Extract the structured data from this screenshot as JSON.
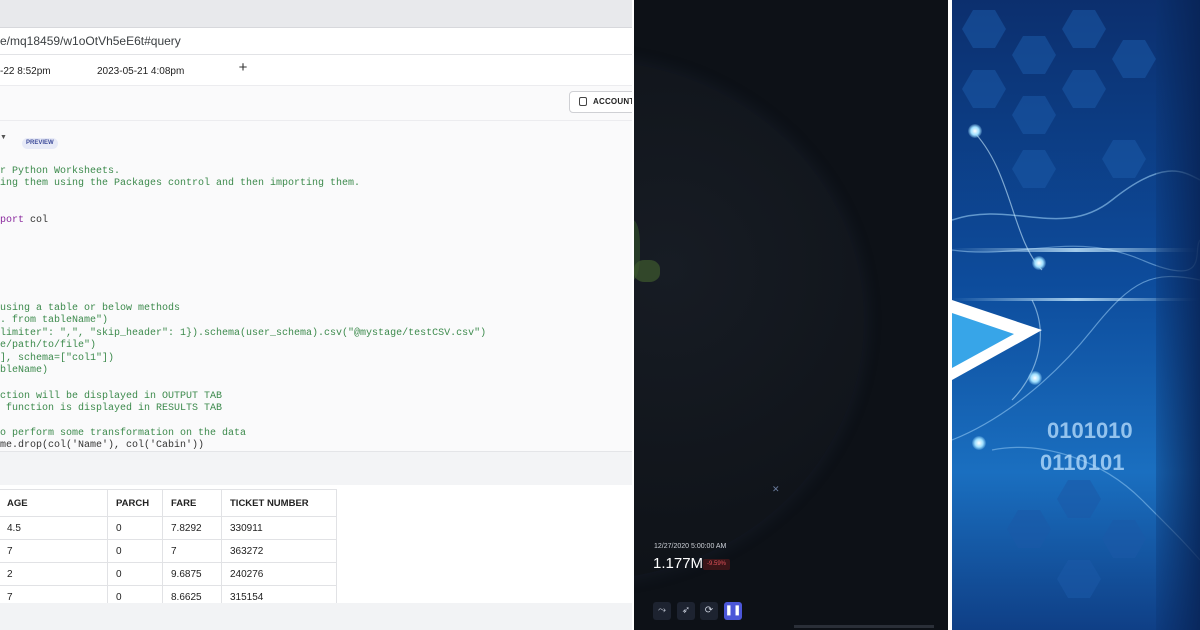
{
  "worksheet": {
    "url": "e/mq18459/w1oOtVh5eE6t#query",
    "tabs": [
      "-22 8:52pm",
      "2023-05-21 4:08pm"
    ],
    "account_label": "ACCOUNT",
    "preview_badge": "PREVIEW",
    "code_lines": [
      {
        "text": "r Python Worksheets.",
        "color": "green"
      },
      {
        "text": "ing them using the Packages control and then importing them.",
        "color": "green"
      },
      {
        "text": "port col",
        "color": "mixed"
      },
      {
        "text": "using a table or below methods",
        "color": "green"
      },
      {
        "text": ". from tableName\")",
        "color": "green"
      },
      {
        "text": "limiter\": \",\", \"skip_header\": 1}).schema(user_schema).csv(\"@mystage/testCSV.csv\")",
        "color": "green"
      },
      {
        "text": "e/path/to/file\")",
        "color": "green"
      },
      {
        "text": "], schema=[\"col1\"])",
        "color": "green"
      },
      {
        "text": "bleName)",
        "color": "green"
      },
      {
        "text": "ction will be displayed in OUTPUT TAB",
        "color": "green"
      },
      {
        "text": " function is displayed in RESULTS TAB",
        "color": "green"
      },
      {
        "text": "o perform some transformation on the data",
        "color": "green"
      },
      {
        "text": "me.drop(col('Name'), col('Cabin'))",
        "color": "dark"
      }
    ],
    "results": {
      "columns": [
        "AGE",
        "PARCH",
        "FARE",
        "TICKET NUMBER"
      ],
      "rows": [
        [
          "4.5",
          "0",
          "7.8292",
          "330911"
        ],
        [
          "7",
          "0",
          "7",
          "363272"
        ],
        [
          "2",
          "0",
          "9.6875",
          "240276"
        ],
        [
          "7",
          "0",
          "8.6625",
          "315154"
        ]
      ]
    }
  },
  "stats": {
    "timestamp": "12/27/2020 5:00:00 AM",
    "value": "1.177M",
    "change": "-9.59%"
  },
  "binary": {
    "line1": "0101010",
    "line2": "0110101"
  },
  "colors": {
    "code_green": "#3c8a4c",
    "keyword_purple": "#8b2a9e",
    "negative_red": "#e2525b",
    "accent_indigo": "#4b56d8"
  }
}
